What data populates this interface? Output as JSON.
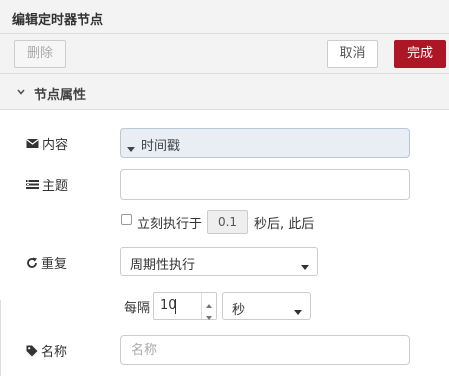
{
  "title": "编辑定时器节点",
  "toolbar": {
    "delete": "删除",
    "cancel": "取消",
    "done": "完成"
  },
  "section": {
    "label": "节点属性"
  },
  "fields": {
    "payload_label": "内容",
    "payload_type": "时间戳",
    "topic_label": "主题",
    "topic_value": "",
    "once_prefix": "立刻执行于",
    "once_delay": "0.1",
    "once_suffix": "秒后, 此后",
    "repeat_label": "重复",
    "repeat_value": "周期性执行",
    "every_label": "每隔",
    "every_value": "10",
    "unit_value": "秒",
    "name_label": "名称",
    "name_placeholder": "名称"
  },
  "colors": {
    "accent": "#ad1625",
    "typed_bg": "#e9eef5",
    "toolbar_bg": "#f3f3f3"
  },
  "icons": [
    "chevron-down-icon",
    "envelope-icon",
    "list-icon",
    "refresh-icon",
    "tag-icon",
    "caret-down-icon"
  ]
}
